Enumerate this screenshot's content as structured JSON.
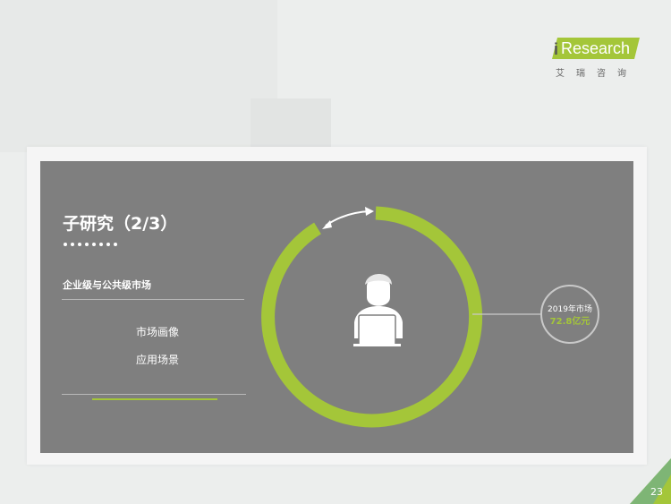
{
  "brand": {
    "logo_text": "Research",
    "logo_i": "i",
    "logo_subtitle": "艾瑞咨询"
  },
  "slide": {
    "title": "子研究（2/3）",
    "section_label": "企业级与公共级市场",
    "items": [
      {
        "label": "市场画像"
      },
      {
        "label": "应用场景"
      }
    ],
    "market": {
      "year_label": "2019年市场",
      "value_label": "72.8亿元"
    },
    "center_icon": "user-laptop-icon",
    "page_number": "23"
  },
  "colors": {
    "accent": "#a4c639",
    "panel": "#7f7f7f",
    "background": "#eceeed"
  }
}
